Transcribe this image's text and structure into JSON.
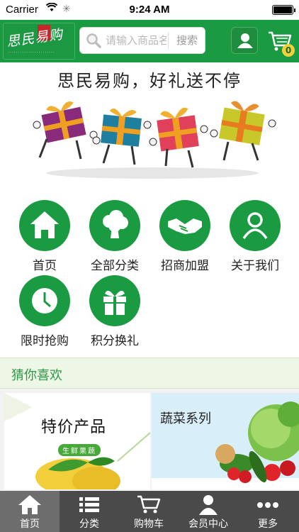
{
  "status_bar": {
    "carrier": "Carrier",
    "time": "9:24 AM"
  },
  "header": {
    "logo_text": "思民易购",
    "search": {
      "placeholder": "请输入商品名",
      "button_label": "搜索"
    },
    "cart_count": "0"
  },
  "banner": {
    "title": "思民易购，好礼送不停"
  },
  "categories": [
    {
      "label": "首页",
      "icon": "home-icon"
    },
    {
      "label": "全部分类",
      "icon": "broccoli-icon"
    },
    {
      "label": "招商加盟",
      "icon": "handshake-icon"
    },
    {
      "label": "关于我们",
      "icon": "person-icon"
    },
    {
      "label": "限时抢购",
      "icon": "clock-icon"
    },
    {
      "label": "积分换礼",
      "icon": "gift-icon"
    }
  ],
  "recommend": {
    "title": "猜你喜欢",
    "cards": [
      {
        "title": "特价产品",
        "tag": "生鲜果蔬"
      },
      {
        "title": "蔬菜系列"
      }
    ]
  },
  "tabbar": {
    "active_index": 0,
    "tabs": [
      {
        "label": "首页",
        "icon": "home-icon"
      },
      {
        "label": "分类",
        "icon": "list-icon"
      },
      {
        "label": "购物车",
        "icon": "cart-icon"
      },
      {
        "label": "会员中心",
        "icon": "user-icon"
      },
      {
        "label": "更多",
        "icon": "more-icon"
      }
    ]
  },
  "colors": {
    "brand_green": "#1a9a41",
    "tabbar": "#4a4a4a",
    "tabbar_active": "#6d6d6d",
    "badge": "#f3d03a"
  }
}
